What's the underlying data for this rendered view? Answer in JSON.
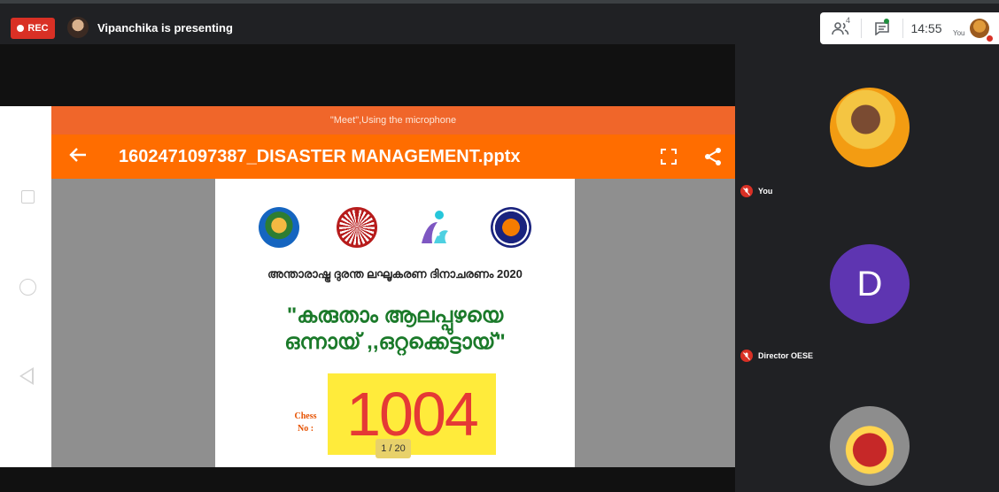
{
  "meeting": {
    "rec_label": "REC",
    "presenter_text": "Vipanchika is presenting",
    "participants_count": "4",
    "time": "14:55",
    "you_label": "You"
  },
  "device": {
    "status_text": "\"Meet\",Using the microphone",
    "filename": "1602471097387_DISASTER MANAGEMENT.pptx",
    "page_indicator": "1 / 20"
  },
  "slide": {
    "subtitle": "അന്താരാഷ്ട്ര ദുരന്ത ലഘൂകരണ ദിനാചരണം 2020",
    "quote_line1": "\"കരുതാം ആലപ്പുഴയെ",
    "quote_line2": "ഒന്നായ് ,,ഒറ്റക്കെട്ടായ്\"",
    "chess_label_line1": "Chess",
    "chess_label_line2": "No :",
    "chess_number": "1004"
  },
  "participants": [
    {
      "name": "You",
      "avatar": "photo",
      "muted": true
    },
    {
      "name": "Director OESE",
      "avatar": "D",
      "muted": true
    },
    {
      "name": "",
      "avatar": "photo",
      "muted": false
    }
  ],
  "colors": {
    "rec": "#d93025",
    "app_bar": "#ff6d00",
    "status_bar": "#f0662a",
    "avatar_d": "#5e35b1",
    "chess_box": "#ffeb3b",
    "chess_number": "#e53935"
  }
}
